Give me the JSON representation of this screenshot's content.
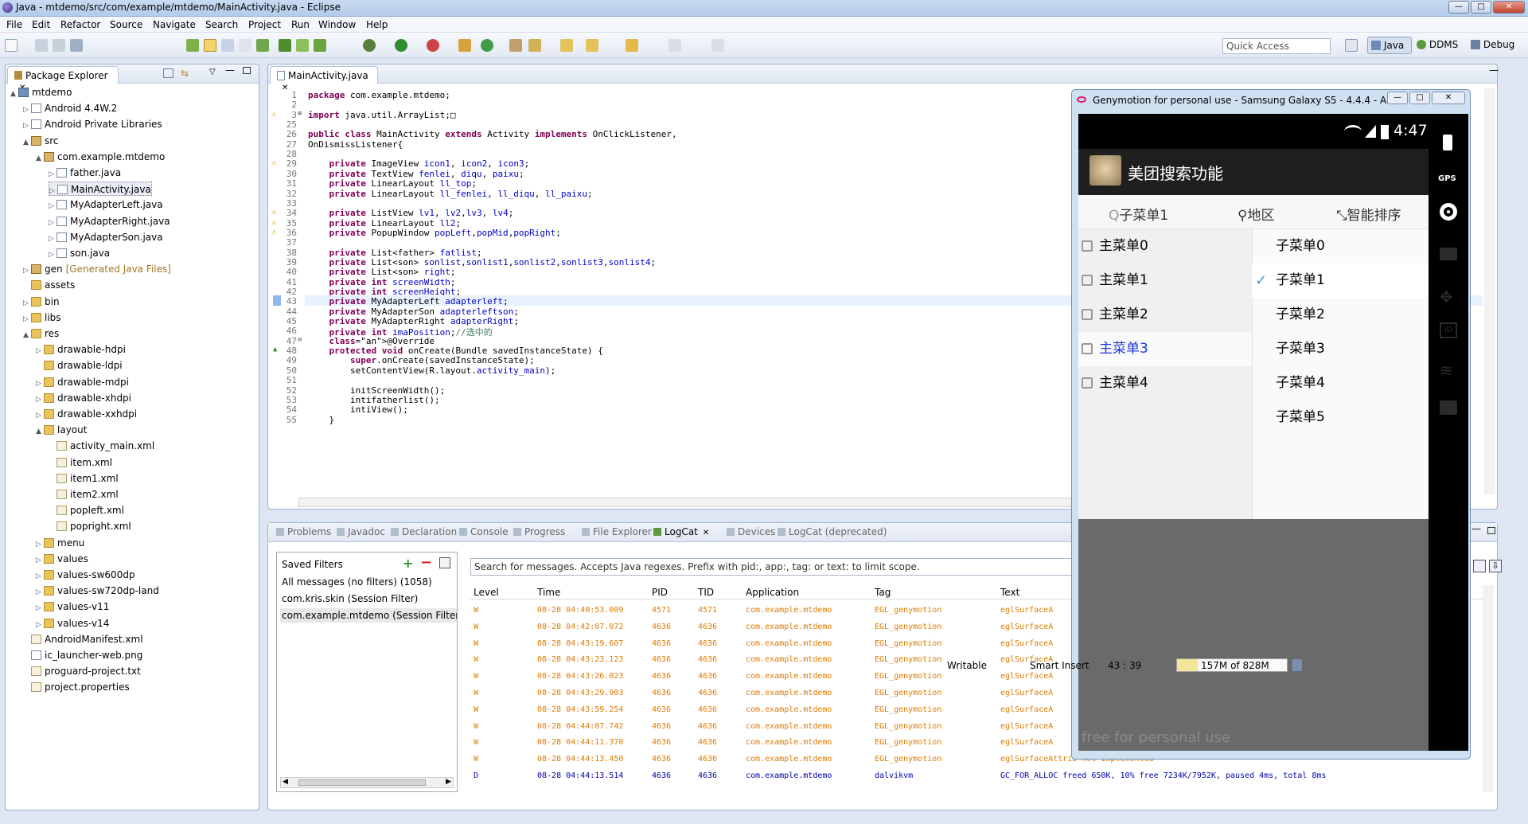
{
  "window": {
    "title": "Java - mtdemo/src/com/example/mtdemo/MainActivity.java - Eclipse"
  },
  "menu": [
    "File",
    "Edit",
    "Refactor",
    "Source",
    "Navigate",
    "Search",
    "Project",
    "Run",
    "Window",
    "Help"
  ],
  "toolbar": {
    "quick_access": "Quick Access",
    "perspectives": [
      "Java",
      "DDMS",
      "Debug"
    ]
  },
  "package_explorer": {
    "title": "Package Explorer",
    "tree": [
      {
        "label": "mtdemo",
        "depth": 0,
        "icon": "project-icon",
        "arrow": "▲"
      },
      {
        "label": "Android 4.4W.2",
        "depth": 1,
        "icon": "library-icon",
        "arrow": "▷"
      },
      {
        "label": "Android Private Libraries",
        "depth": 1,
        "icon": "library-icon",
        "arrow": "▷"
      },
      {
        "label": "src",
        "depth": 1,
        "icon": "source-folder-icon",
        "arrow": "▲"
      },
      {
        "label": "com.example.mtdemo",
        "depth": 2,
        "icon": "package-icon",
        "arrow": "▲"
      },
      {
        "label": "father.java",
        "depth": 3,
        "icon": "java-file-icon",
        "arrow": "▷"
      },
      {
        "label": "MainActivity.java",
        "depth": 3,
        "icon": "java-file-icon",
        "arrow": "▷",
        "selected": true
      },
      {
        "label": "MyAdapterLeft.java",
        "depth": 3,
        "icon": "java-file-icon",
        "arrow": "▷"
      },
      {
        "label": "MyAdapterRight.java",
        "depth": 3,
        "icon": "java-file-icon",
        "arrow": "▷"
      },
      {
        "label": "MyAdapterSon.java",
        "depth": 3,
        "icon": "java-file-icon",
        "arrow": "▷"
      },
      {
        "label": "son.java",
        "depth": 3,
        "icon": "java-file-icon",
        "arrow": "▷"
      },
      {
        "label": "gen",
        "suffix": "[Generated Java Files]",
        "depth": 1,
        "icon": "source-folder-icon",
        "arrow": "▷"
      },
      {
        "label": "assets",
        "depth": 1,
        "icon": "folder-icon",
        "arrow": ""
      },
      {
        "label": "bin",
        "depth": 1,
        "icon": "folder-icon",
        "arrow": "▷"
      },
      {
        "label": "libs",
        "depth": 1,
        "icon": "folder-icon",
        "arrow": "▷"
      },
      {
        "label": "res",
        "depth": 1,
        "icon": "folder-icon",
        "arrow": "▲"
      },
      {
        "label": "drawable-hdpi",
        "depth": 2,
        "icon": "folder-icon",
        "arrow": "▷"
      },
      {
        "label": "drawable-ldpi",
        "depth": 2,
        "icon": "folder-icon",
        "arrow": ""
      },
      {
        "label": "drawable-mdpi",
        "depth": 2,
        "icon": "folder-icon",
        "arrow": "▷"
      },
      {
        "label": "drawable-xhdpi",
        "depth": 2,
        "icon": "folder-icon",
        "arrow": "▷"
      },
      {
        "label": "drawable-xxhdpi",
        "depth": 2,
        "icon": "folder-icon",
        "arrow": "▷"
      },
      {
        "label": "layout",
        "depth": 2,
        "icon": "folder-icon",
        "arrow": "▲"
      },
      {
        "label": "activity_main.xml",
        "depth": 3,
        "icon": "xml-file-icon",
        "arrow": ""
      },
      {
        "label": "item.xml",
        "depth": 3,
        "icon": "xml-file-icon",
        "arrow": ""
      },
      {
        "label": "item1.xml",
        "depth": 3,
        "icon": "xml-file-icon",
        "arrow": ""
      },
      {
        "label": "item2.xml",
        "depth": 3,
        "icon": "xml-file-icon",
        "arrow": ""
      },
      {
        "label": "popleft.xml",
        "depth": 3,
        "icon": "xml-file-icon",
        "arrow": ""
      },
      {
        "label": "popright.xml",
        "depth": 3,
        "icon": "xml-file-icon",
        "arrow": ""
      },
      {
        "label": "menu",
        "depth": 2,
        "icon": "folder-icon",
        "arrow": "▷"
      },
      {
        "label": "values",
        "depth": 2,
        "icon": "folder-icon",
        "arrow": "▷"
      },
      {
        "label": "values-sw600dp",
        "depth": 2,
        "icon": "folder-icon",
        "arrow": "▷"
      },
      {
        "label": "values-sw720dp-land",
        "depth": 2,
        "icon": "folder-icon",
        "arrow": "▷"
      },
      {
        "label": "values-v11",
        "depth": 2,
        "icon": "folder-icon",
        "arrow": "▷"
      },
      {
        "label": "values-v14",
        "depth": 2,
        "icon": "folder-icon",
        "arrow": "▷"
      },
      {
        "label": "AndroidManifest.xml",
        "depth": 1,
        "icon": "xml-file-icon",
        "arrow": ""
      },
      {
        "label": "ic_launcher-web.png",
        "depth": 1,
        "icon": "image-file-icon",
        "arrow": ""
      },
      {
        "label": "proguard-project.txt",
        "depth": 1,
        "icon": "text-file-icon",
        "arrow": ""
      },
      {
        "label": "project.properties",
        "depth": 1,
        "icon": "text-file-icon",
        "arrow": ""
      }
    ]
  },
  "editor": {
    "tab": "MainActivity.java",
    "lines": [
      {
        "n": "1",
        "t": "package com.example.mtdemo;"
      },
      {
        "n": "2",
        "t": ""
      },
      {
        "n": "3",
        "t": "import java.util.ArrayList;□",
        "fold": "⊕",
        "warn": true
      },
      {
        "n": "25",
        "t": ""
      },
      {
        "n": "26",
        "t": "public class MainActivity extends Activity implements OnClickListener,"
      },
      {
        "n": "27",
        "t": "OnDismissListener{"
      },
      {
        "n": "28",
        "t": ""
      },
      {
        "n": "29",
        "t": "    private ImageView icon1, icon2, icon3;",
        "warn": true
      },
      {
        "n": "30",
        "t": "    private TextView fenlei, diqu, paixu;"
      },
      {
        "n": "31",
        "t": "    private LinearLayout ll_top;"
      },
      {
        "n": "32",
        "t": "    private LinearLayout ll_fenlei, ll_diqu, ll_paixu;"
      },
      {
        "n": "33",
        "t": ""
      },
      {
        "n": "34",
        "t": "    private ListView lv1, lv2,lv3, lv4;",
        "warn": true
      },
      {
        "n": "35",
        "t": "    private LinearLayout ll2;",
        "warn": true
      },
      {
        "n": "36",
        "t": "    private PopupWindow popLeft,popMid,popRight;",
        "warn": true
      },
      {
        "n": "37",
        "t": ""
      },
      {
        "n": "38",
        "t": "    private List<father> fatlist;"
      },
      {
        "n": "39",
        "t": "    private List<son> sonlist,sonlist1,sonlist2,sonlist3,sonlist4;"
      },
      {
        "n": "40",
        "t": "    private List<son> right;"
      },
      {
        "n": "41",
        "t": "    private int screenWidth;"
      },
      {
        "n": "42",
        "t": "    private int screenHeight;"
      },
      {
        "n": "43",
        "t": "    private MyAdapterLeft adapterleft;",
        "current": true
      },
      {
        "n": "44",
        "t": "    private MyAdapterSon adapterleftson;"
      },
      {
        "n": "45",
        "t": "    private MyAdapterRight adapterRight;"
      },
      {
        "n": "46",
        "t": "    private int imaPosition;//选中的"
      },
      {
        "n": "47",
        "t": "    @Override",
        "fold": "⊖"
      },
      {
        "n": "48",
        "t": "    protected void onCreate(Bundle savedInstanceState) {",
        "override": true
      },
      {
        "n": "49",
        "t": "        super.onCreate(savedInstanceState);"
      },
      {
        "n": "50",
        "t": "        setContentView(R.layout.activity_main);"
      },
      {
        "n": "51",
        "t": ""
      },
      {
        "n": "52",
        "t": "        initScreenWidth();"
      },
      {
        "n": "53",
        "t": "        intifatherlist();"
      },
      {
        "n": "54",
        "t": "        intiView();"
      },
      {
        "n": "55",
        "t": "    }"
      }
    ]
  },
  "bottom_tabs": [
    "Problems",
    "Javadoc",
    "Declaration",
    "Console",
    "Progress",
    "File Explorer",
    "LogCat",
    "Devices",
    "LogCat (deprecated)"
  ],
  "logcat": {
    "saved_filters_title": "Saved Filters",
    "filters": [
      "All messages (no filters) (1058)",
      "com.kris.skin (Session Filter)",
      "com.example.mtdemo (Session Filter"
    ],
    "search_placeholder": "Search for messages. Accepts Java regexes. Prefix with pid:, app:, tag: or text: to limit scope.",
    "columns": [
      "Level",
      "Time",
      "PID",
      "TID",
      "Application",
      "Tag",
      "Text"
    ],
    "rows": [
      {
        "level": "W",
        "time": "08-28 04:40:53.009",
        "pid": "4571",
        "tid": "4571",
        "app": "com.example.mtdemo",
        "tag": "EGL_genymotion",
        "text": "eglSurfaceA"
      },
      {
        "level": "W",
        "time": "08-28 04:42:07.072",
        "pid": "4636",
        "tid": "4636",
        "app": "com.example.mtdemo",
        "tag": "EGL_genymotion",
        "text": "eglSurfaceA"
      },
      {
        "level": "W",
        "time": "08-28 04:43:19.607",
        "pid": "4636",
        "tid": "4636",
        "app": "com.example.mtdemo",
        "tag": "EGL_genymotion",
        "text": "eglSurfaceA"
      },
      {
        "level": "W",
        "time": "08-28 04:43:23.123",
        "pid": "4636",
        "tid": "4636",
        "app": "com.example.mtdemo",
        "tag": "EGL_genymotion",
        "text": "eglSurfaceA"
      },
      {
        "level": "W",
        "time": "08-28 04:43:26.023",
        "pid": "4636",
        "tid": "4636",
        "app": "com.example.mtdemo",
        "tag": "EGL_genymotion",
        "text": "eglSurfaceA"
      },
      {
        "level": "W",
        "time": "08-28 04:43:29.903",
        "pid": "4636",
        "tid": "4636",
        "app": "com.example.mtdemo",
        "tag": "EGL_genymotion",
        "text": "eglSurfaceA"
      },
      {
        "level": "W",
        "time": "08-28 04:43:59.254",
        "pid": "4636",
        "tid": "4636",
        "app": "com.example.mtdemo",
        "tag": "EGL_genymotion",
        "text": "eglSurfaceA"
      },
      {
        "level": "W",
        "time": "08-28 04:44:07.742",
        "pid": "4636",
        "tid": "4636",
        "app": "com.example.mtdemo",
        "tag": "EGL_genymotion",
        "text": "eglSurfaceA"
      },
      {
        "level": "W",
        "time": "08-28 04:44:11.370",
        "pid": "4636",
        "tid": "4636",
        "app": "com.example.mtdemo",
        "tag": "EGL_genymotion",
        "text": "eglSurfaceA"
      },
      {
        "level": "W",
        "time": "08-28 04:44:13.450",
        "pid": "4636",
        "tid": "4636",
        "app": "com.example.mtdemo",
        "tag": "EGL_genymotion",
        "text": "eglSurfaceAttrib not implemented"
      },
      {
        "level": "D",
        "time": "08-28 04:44:13.514",
        "pid": "4636",
        "tid": "4636",
        "app": "com.example.mtdemo",
        "tag": "dalvikvm",
        "text": "GC_FOR_ALLOC freed 650K, 10% free 7234K/7952K, paused 4ms, total 8ms"
      }
    ]
  },
  "genymotion": {
    "title": "Genymotion for personal use - Samsung Galaxy S5 - 4.4.4 - A...",
    "clock": "4:47",
    "app_title": "美团搜索功能",
    "filters": [
      "子菜单1",
      "地区",
      "智能排序"
    ],
    "left_menu": [
      "主菜单0",
      "主菜单1",
      "主菜单2",
      "主菜单3",
      "主菜单4"
    ],
    "right_menu": [
      "子菜单0",
      "子菜单1",
      "子菜单2",
      "子菜单3",
      "子菜单4",
      "子菜单5"
    ],
    "watermark": "free for personal use",
    "side_icons": [
      "battery-icon",
      "gps-icon",
      "camera-icon",
      "video-icon",
      "move-icon",
      "id-icon",
      "rss-icon",
      "message-icon"
    ],
    "gps_label": "GPS",
    "id_label": "ID"
  },
  "status": {
    "writable": "Writable",
    "insert": "Smart Insert",
    "position": "43 : 39",
    "memory": "157M of 828M"
  },
  "colors": {
    "accent": "#0000ff",
    "selected_row": "#f0f0f0",
    "phone_dark": "#2a2a2a",
    "log_warn": "#e07a00"
  }
}
